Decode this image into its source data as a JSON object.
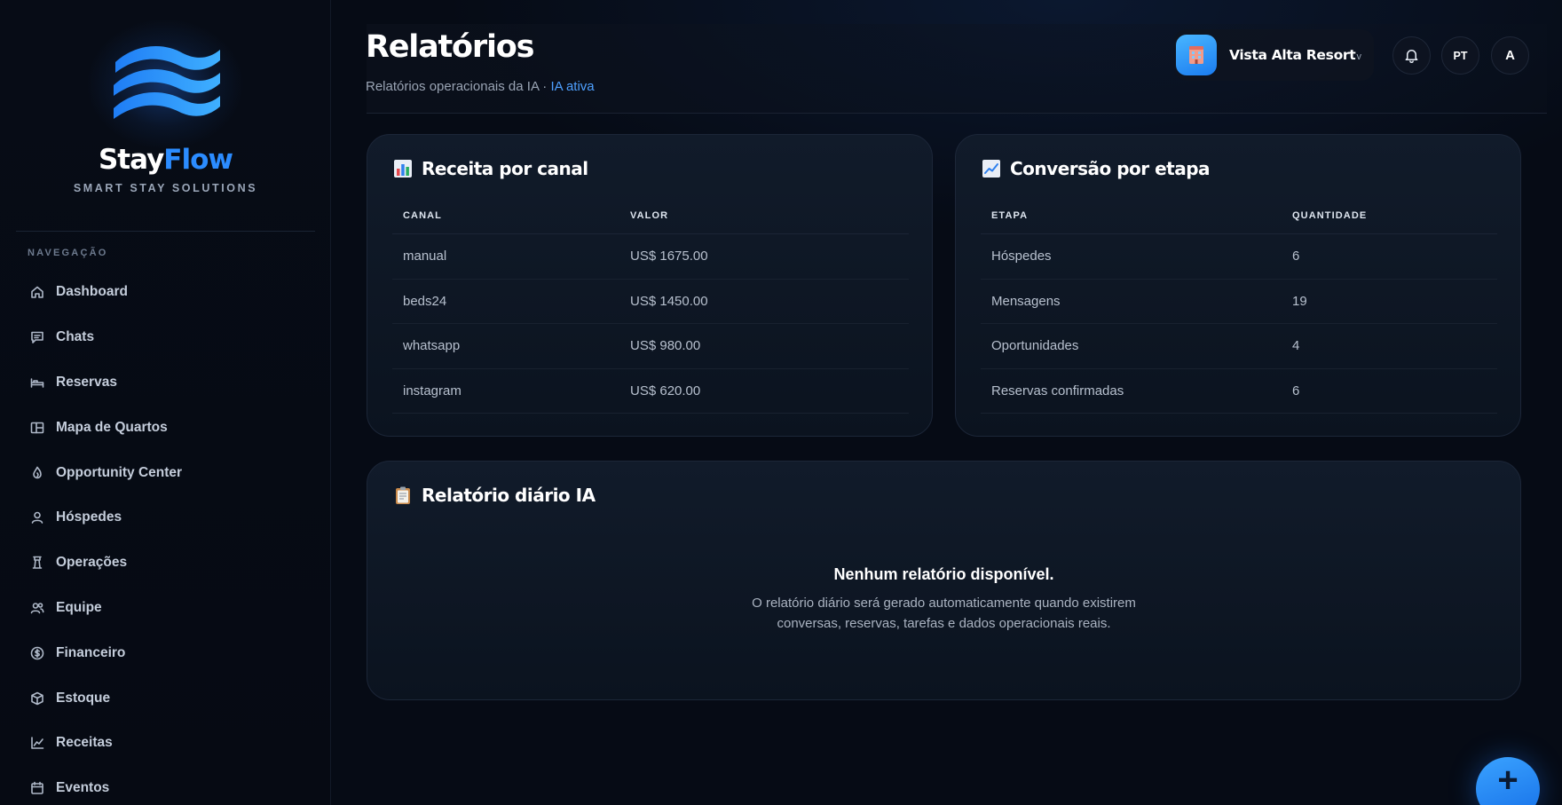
{
  "brand": {
    "name_part1": "Stay",
    "name_part2": "Flow",
    "tagline": "SMART STAY SOLUTIONS",
    "accent": "#2b8cff"
  },
  "sidebar": {
    "section_label": "NAVEGAÇÃO",
    "items": [
      {
        "label": "Dashboard",
        "icon": "home-icon"
      },
      {
        "label": "Chats",
        "icon": "chat-icon"
      },
      {
        "label": "Reservas",
        "icon": "bed-icon"
      },
      {
        "label": "Mapa de Quartos",
        "icon": "layout-icon"
      },
      {
        "label": "Opportunity Center",
        "icon": "flame-icon"
      },
      {
        "label": "Hóspedes",
        "icon": "user-icon"
      },
      {
        "label": "Operações",
        "icon": "tower-icon"
      },
      {
        "label": "Equipe",
        "icon": "users-icon"
      },
      {
        "label": "Financeiro",
        "icon": "dollar-icon"
      },
      {
        "label": "Estoque",
        "icon": "box-icon"
      },
      {
        "label": "Receitas",
        "icon": "chart-line-icon"
      },
      {
        "label": "Eventos",
        "icon": "calendar-icon"
      }
    ]
  },
  "header": {
    "title": "Relatórios",
    "subtitle": "Relatórios operacionais da IA · ",
    "ai_status": "IA ativa",
    "hotel": {
      "name": "Vista Alta Resort",
      "avatar_icon": "hotel-icon",
      "chevron": "v"
    },
    "notifications_icon": "bell-icon",
    "language": "PT",
    "user_initial": "A"
  },
  "revenue_card": {
    "title": "Receita por canal",
    "icon": "bar-chart-icon",
    "columns": [
      "CANAL",
      "VALOR"
    ],
    "rows": [
      [
        "manual",
        "US$ 1675.00"
      ],
      [
        "beds24",
        "US$ 1450.00"
      ],
      [
        "whatsapp",
        "US$ 980.00"
      ],
      [
        "instagram",
        "US$ 620.00"
      ]
    ]
  },
  "conversion_card": {
    "title": "Conversão por etapa",
    "icon": "trend-chart-icon",
    "columns": [
      "ETAPA",
      "QUANTIDADE"
    ],
    "rows": [
      [
        "Hóspedes",
        "6"
      ],
      [
        "Mensagens",
        "19"
      ],
      [
        "Oportunidades",
        "4"
      ],
      [
        "Reservas confirmadas",
        "6"
      ]
    ]
  },
  "daily_report": {
    "title": "Relatório diário IA",
    "icon": "clipboard-icon",
    "empty_title": "Nenhum relatório disponível.",
    "empty_desc_line1": "O relatório diário será gerado automaticamente quando existirem",
    "empty_desc_line2": "conversas, reservas, tarefas e dados operacionais reais."
  },
  "fab": {
    "label": "+",
    "icon": "plus-icon"
  }
}
